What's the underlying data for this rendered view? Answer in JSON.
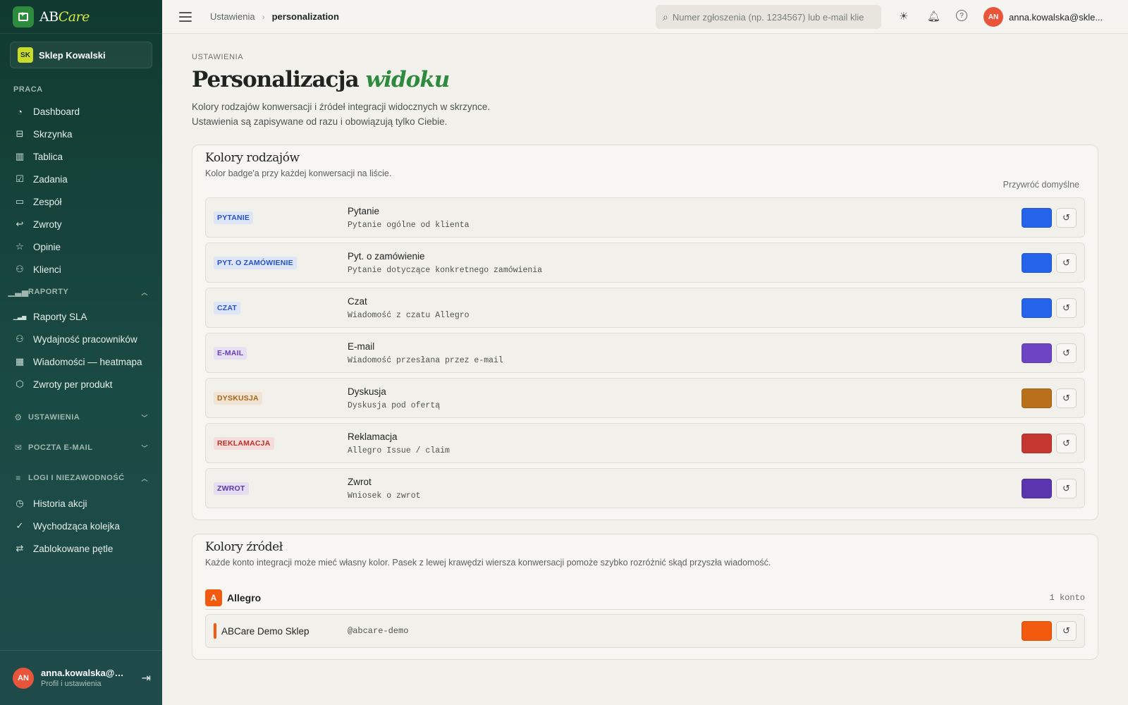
{
  "brand": {
    "name_a": "AB",
    "name_b": "Care"
  },
  "shop": {
    "initials": "SK",
    "name": "Sklep Kowalski"
  },
  "nav": {
    "praca_title": "PRACA",
    "praca_items": [
      {
        "label": "Dashboard",
        "icon": "dashboard-icon"
      },
      {
        "label": "Skrzynka",
        "icon": "inbox-icon"
      },
      {
        "label": "Tablica",
        "icon": "board-icon"
      },
      {
        "label": "Zadania",
        "icon": "tasks-icon"
      },
      {
        "label": "Zespół",
        "icon": "team-icon"
      },
      {
        "label": "Zwroty",
        "icon": "returns-icon"
      },
      {
        "label": "Opinie",
        "icon": "star-icon"
      },
      {
        "label": "Klienci",
        "icon": "clients-icon"
      }
    ],
    "raporty_title": "RAPORTY",
    "raporty_items": [
      {
        "label": "Raporty SLA",
        "icon": "bar-chart-icon"
      },
      {
        "label": "Wydajność pracowników",
        "icon": "user-performance-icon"
      },
      {
        "label": "Wiadomości — heatmapa",
        "icon": "grid-icon"
      },
      {
        "label": "Zwroty per produkt",
        "icon": "package-icon"
      }
    ],
    "ustawienia_title": "USTAWIENIA",
    "poczta_title": "POCZTA E-MAIL",
    "logi_title": "LOGI I NIEZAWODNOŚĆ",
    "logi_items": [
      {
        "label": "Historia akcji",
        "icon": "history-icon"
      },
      {
        "label": "Wychodząca kolejka",
        "icon": "check-circle-icon"
      },
      {
        "label": "Zablokowane pętle",
        "icon": "loop-icon"
      }
    ]
  },
  "footer": {
    "initials": "AN",
    "name": "anna.kowalska@s...",
    "sub": "Profil i ustawienia"
  },
  "topbar": {
    "crumb_parent": "Ustawienia",
    "crumb_current": "personalization",
    "search_placeholder": "Numer zgłoszenia (np. 1234567) lub e-mail klie",
    "user_initials": "AN",
    "user_email": "anna.kowalska@skle..."
  },
  "page": {
    "eyebrow": "USTAWIENIA",
    "title_a": "Personalizacja ",
    "title_b": "widoku",
    "desc1": "Kolory rodzajów konwersacji i źródeł integracji widocznych w skrzynce.",
    "desc2": "Ustawienia są zapisywane od razu i obowiązują tylko Ciebie."
  },
  "types_card": {
    "title": "Kolory rodzajów",
    "subtitle": "Kolor badge'a przy każdej konwersacji na liście.",
    "reset_all": "Przywróć domyślne",
    "rows": [
      {
        "badge": "PYTANIE",
        "label": "Pytanie",
        "desc": "Pytanie ogólne od klienta",
        "color": "#2563eb",
        "badge_bg": "#dde5f7",
        "badge_fg": "#2453c4"
      },
      {
        "badge": "PYT. O ZAMÓWIENIE",
        "label": "Pyt. o zamówienie",
        "desc": "Pytanie dotyczące konkretnego zamówienia",
        "color": "#2563eb",
        "badge_bg": "#dde5f7",
        "badge_fg": "#2453c4"
      },
      {
        "badge": "CZAT",
        "label": "Czat",
        "desc": "Wiadomość z czatu Allegro",
        "color": "#2563eb",
        "badge_bg": "#dde5f7",
        "badge_fg": "#2453c4"
      },
      {
        "badge": "E-MAIL",
        "label": "E-mail",
        "desc": "Wiadomość przesłana przez e-mail",
        "color": "#6d45c4",
        "badge_bg": "#e7e0f3",
        "badge_fg": "#6a3fb5"
      },
      {
        "badge": "DYSKUSJA",
        "label": "Dyskusja",
        "desc": "Dyskusja pod ofertą",
        "color": "#b8701c",
        "badge_bg": "#f1e4d2",
        "badge_fg": "#a5641a"
      },
      {
        "badge": "REKLAMACJA",
        "label": "Reklamacja",
        "desc": "Allegro Issue / claim",
        "color": "#c4362f",
        "badge_bg": "#f3dcd9",
        "badge_fg": "#bb3128"
      },
      {
        "badge": "ZWROT",
        "label": "Zwrot",
        "desc": "Wniosek o zwrot",
        "color": "#5b35ad",
        "badge_bg": "#e5def1",
        "badge_fg": "#5b35ad"
      }
    ]
  },
  "sources_card": {
    "title": "Kolory źródeł",
    "subtitle": "Każde konto integracji może mieć własny kolor. Pasek z lewej krawędzi wiersza konwersacji pomoże szybko rozróżnić skąd przyszła wiadomość.",
    "source": {
      "logo": "A",
      "name": "Allegro",
      "count": "1 konto"
    },
    "account": {
      "name": "ABCare Demo Sklep",
      "handle": "@abcare-demo",
      "color": "#f25a0f"
    }
  }
}
